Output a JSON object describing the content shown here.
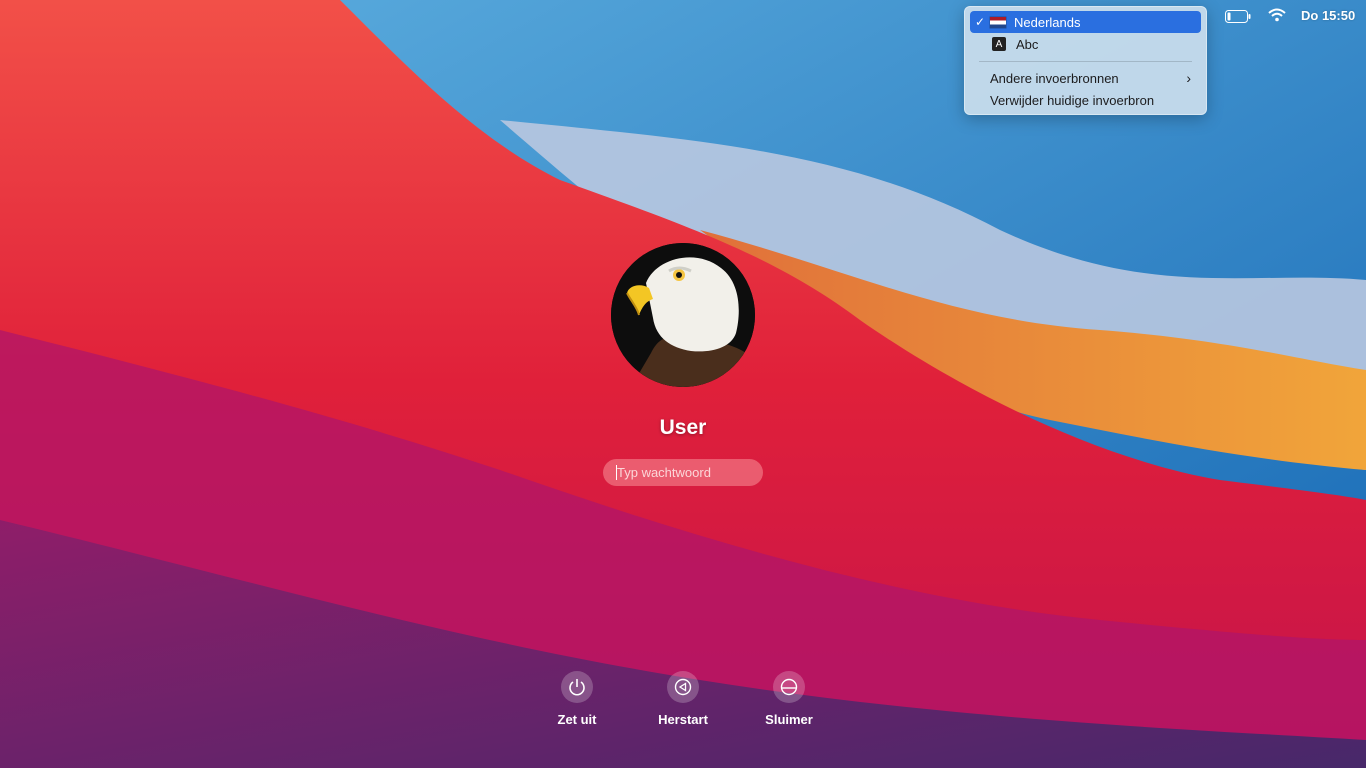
{
  "menubar": {
    "clock": "Do 15:50",
    "icons": [
      "battery-icon",
      "wifi-icon"
    ]
  },
  "input_menu": {
    "items": [
      {
        "label": "Nederlands",
        "selected": true,
        "icon": "netherlands-flag-icon"
      },
      {
        "label": "Abc",
        "selected": false,
        "icon": "abc-keyboard-icon"
      },
      {
        "label": "Andere invoerbronnen",
        "submenu": true
      },
      {
        "label": "Verwijder huidige invoerbron"
      }
    ],
    "highlight_color": "#2a6fe0"
  },
  "login": {
    "username": "User",
    "password_placeholder": "Typ wachtwoord",
    "avatar": "bald-eagle-avatar"
  },
  "actions": [
    {
      "label": "Zet uit",
      "icon": "power-icon"
    },
    {
      "label": "Herstart",
      "icon": "restart-icon"
    },
    {
      "label": "Sluimer",
      "icon": "sleep-icon"
    }
  ]
}
